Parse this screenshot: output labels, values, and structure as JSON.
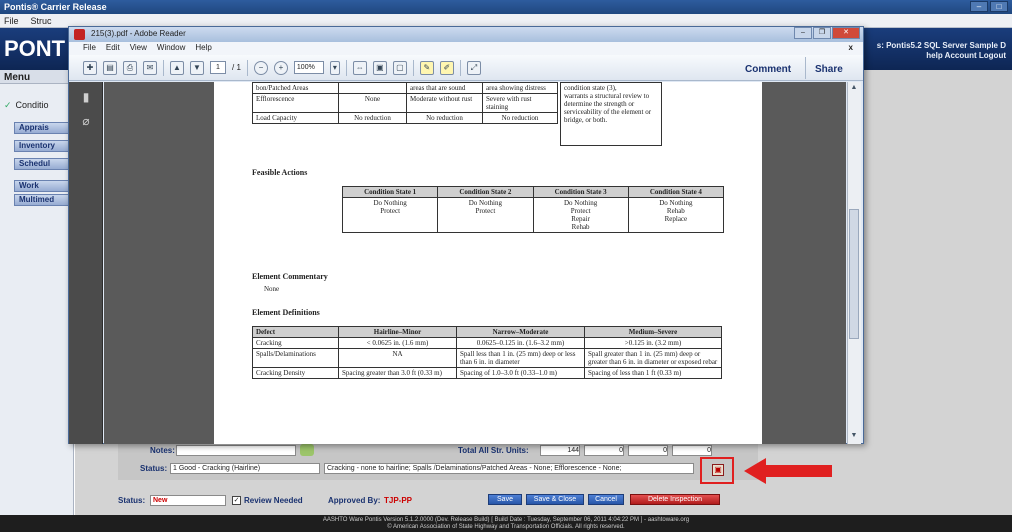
{
  "app": {
    "title": "Pontis® Carrier Release",
    "menu": [
      "File",
      "Struc"
    ],
    "brand": "PONT",
    "banner_line1": "s: Pontis5.2 SQL Server Sample D",
    "banner_line2": "help   Account  Logout",
    "sidebar_header": "Menu",
    "condition_item": "Conditio",
    "sidebar_buttons": [
      "Apprais",
      "Inventory",
      "Schedul",
      "Work",
      "Multimed"
    ]
  },
  "reader": {
    "title": "215(3).pdf - Adobe Reader",
    "menu": [
      "File",
      "Edit",
      "View",
      "Window",
      "Help"
    ],
    "menu_close": "x",
    "page_value": "1",
    "page_total": "/ 1",
    "zoom": "100%",
    "comment": "Comment",
    "share": "Share"
  },
  "doc": {
    "top_table": {
      "rows": [
        [
          "bon/Patched Areas",
          "",
          "areas that are sound",
          "area showing distress"
        ],
        [
          "Efflorescence",
          "None",
          "Moderate without rust",
          "Severe with rust staining"
        ],
        [
          "Load Capacity",
          "No reduction",
          "No reduction",
          "No reduction"
        ]
      ],
      "side_note": "warrants a structural review to determine the strength or serviceability of the element or bridge, or both.",
      "side_note_head": "condition state (3),"
    },
    "feasible_title": "Feasible Actions",
    "feasible": {
      "headers": [
        "Condition State 1",
        "Condition State 2",
        "Condition State 3",
        "Condition State 4"
      ],
      "cells": [
        "Do Nothing\nProtect",
        "Do Nothing\nProtect",
        "Do Nothing\nProtect\nRepair\nRehab",
        "Do Nothing\nRehab\nReplace"
      ]
    },
    "commentary_title": "Element Commentary",
    "commentary": "None",
    "definitions_title": "Element Definitions",
    "definitions": {
      "headers": [
        "Defect",
        "Hairline–Minor",
        "Narrow–Moderate",
        "Medium–Severe"
      ],
      "rows": [
        [
          "Cracking",
          "< 0.0625 in. (1.6 mm)",
          "0.0625–0.125 in. (1.6–3.2 mm)",
          ">0.125 in. (3.2 mm)"
        ],
        [
          "Spalls/Delaminations",
          "NA",
          "Spall less than 1 in. (25 mm) deep or less than 6 in. in diameter",
          "Spall greater than 1 in. (25 mm) deep or greater than 6 in. in diameter or exposed rebar"
        ],
        [
          "Cracking Density",
          "Spacing greater than 3.0 ft (0.33 m)",
          "Spacing of 1.0–3.0 ft (0.33–1.0 m)",
          "Spacing of less than 1 ft (0.33 m)"
        ]
      ]
    }
  },
  "form": {
    "notes_label": "Notes:",
    "total_label": "Total All Str. Units:",
    "total_values": [
      "144",
      "0",
      "0",
      "0"
    ],
    "status_label": "Status:",
    "status_value": "1 Good - Cracking (Hairline)",
    "status_desc": "Cracking - none to hairline; Spalls /Delaminations/Patched Areas - None; Efflorescence - None;",
    "bottom_status_label": "Status:",
    "bottom_status_value": "New",
    "review_label": "Review Needed",
    "approved_label": "Approved By:",
    "approved_value": "TJP-PP",
    "buttons": [
      "Save",
      "Save & Close",
      "Cancel",
      "Delete Inspection"
    ]
  },
  "footer": {
    "line1": "AASHTO Ware Pontis Version 5.1.2.0000 (Dev. Release Build) [ Build Date : Tuesday, September 06, 2011 4:04:22 PM ] - aashtoware.org",
    "line2": "© American Association of State Highway and Transportation Officials. All rights reserved."
  },
  "colors": {
    "banner": "#1a3d7c",
    "highlight": "#e02020",
    "delete_button": "#c62828"
  }
}
